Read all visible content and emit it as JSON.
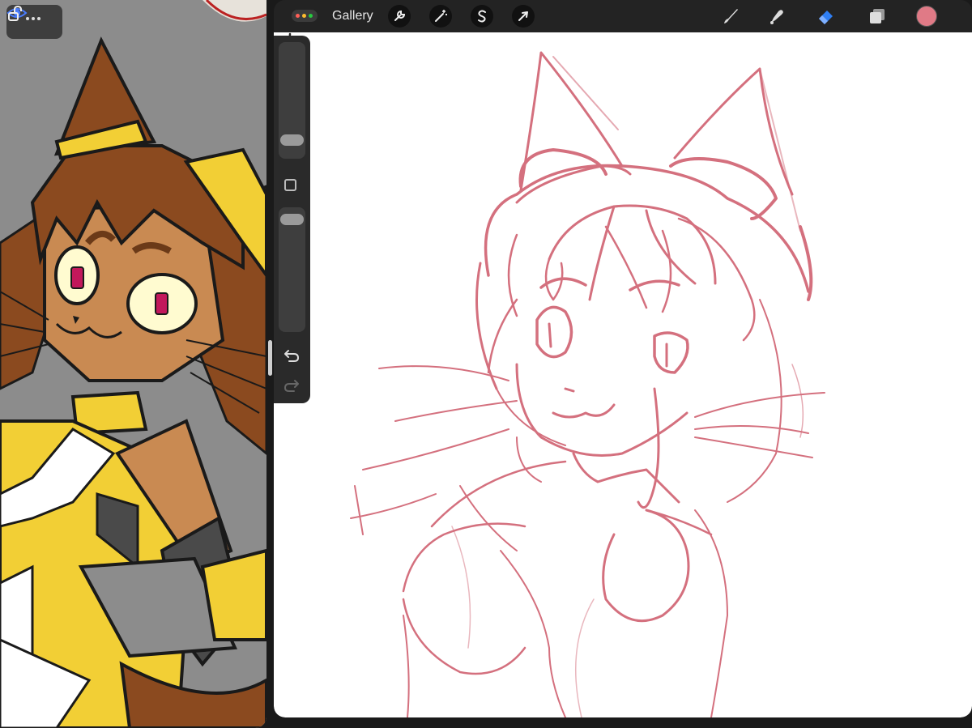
{
  "app": {
    "gallery_label": "Gallery",
    "toolbar_left": [
      {
        "name": "actions",
        "icon": "wrench-icon"
      },
      {
        "name": "adjustments",
        "icon": "magic-wand-icon"
      },
      {
        "name": "selection",
        "icon": "selection-s-icon"
      },
      {
        "name": "transform",
        "icon": "arrow-cursor-icon"
      }
    ],
    "toolbar_right": [
      {
        "name": "brush",
        "icon": "brush-icon",
        "active": false
      },
      {
        "name": "smudge",
        "icon": "smudge-icon",
        "active": false
      },
      {
        "name": "eraser",
        "icon": "eraser-icon",
        "active": true
      },
      {
        "name": "layers",
        "icon": "layers-icon",
        "active": false
      }
    ],
    "current_color": "#e07a86",
    "active_tool_color": "#2f7ff5",
    "sketch_color": "#d4707e",
    "window_dot_colors": [
      "#ff5f57",
      "#febc2e",
      "#28c840"
    ]
  },
  "sidebar": {
    "brush_size_icon": "slider-handle",
    "modify_icon": "square-icon",
    "undo_icon": "undo-icon",
    "redo_icon": "redo-icon"
  },
  "reference": {
    "eye_icon": "eye-icon",
    "lock_icon": "unlock-icon",
    "drag_icon": "more-dots-icon",
    "palette": {
      "background": "#8c8c8c",
      "hair": "#8b4a1f",
      "skin": "#c98a52",
      "suit": "#f2cf35",
      "stripe": "#ffffff",
      "glove": "#4a4a4a",
      "eye": "#c2185b"
    }
  }
}
